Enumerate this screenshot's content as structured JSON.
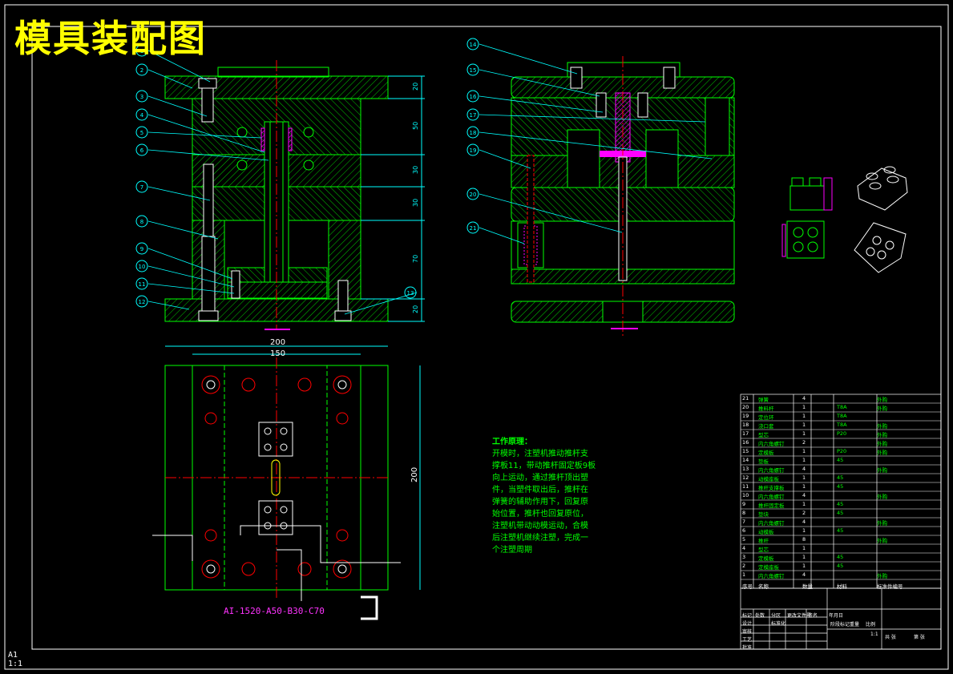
{
  "title": "模具装配图",
  "working_principle": {
    "heading": "工作原理：",
    "lines": [
      "开模时，注塑机推动推杆支",
      "撑板11，带动推杆固定板9板",
      "向上运动，通过推杆顶出塑",
      "件，当塑件取出后，推杆在",
      "弹簧的辅助作用下，回复原",
      "始位置，推杆也回复原位，",
      "注塑机带动动模运动，合模",
      "后注塑机继续注塑，完成一",
      "个注塑周期"
    ]
  },
  "base_code": "AI-1520-A50-B30-C70",
  "sheet": {
    "size": "A1",
    "scale": "1:1"
  },
  "dimensions": {
    "plan_width_outer": "200",
    "plan_width_inner": "150",
    "plan_height": "200",
    "section_heights": [
      "20",
      "50",
      "30",
      "30",
      "70",
      "20"
    ]
  },
  "balloons_left": [
    "1",
    "2",
    "3",
    "4",
    "5",
    "6",
    "7",
    "8",
    "9",
    "10",
    "11",
    "12",
    "13"
  ],
  "balloons_right": [
    "14",
    "15",
    "16",
    "17",
    "18",
    "19",
    "20",
    "21"
  ],
  "bom": {
    "rows": [
      [
        "21",
        "弹簧",
        "4",
        "",
        "外购"
      ],
      [
        "20",
        "推料杆",
        "1",
        "T8A",
        "外购"
      ],
      [
        "19",
        "定位环",
        "1",
        "T8A",
        ""
      ],
      [
        "18",
        "浇口套",
        "1",
        "T8A",
        "外购"
      ],
      [
        "17",
        "型芯",
        "1",
        "P20",
        "外购"
      ],
      [
        "16",
        "内六角螺钉",
        "2",
        "",
        "外购"
      ],
      [
        "15",
        "定模板",
        "1",
        "P20",
        "外购"
      ],
      [
        "14",
        "垫板",
        "1",
        "45",
        ""
      ],
      [
        "13",
        "内六角螺钉",
        "4",
        "",
        "外购"
      ],
      [
        "12",
        "动模座板",
        "1",
        "45",
        ""
      ],
      [
        "11",
        "推杆支撑板",
        "1",
        "45",
        ""
      ],
      [
        "10",
        "内六角螺钉",
        "4",
        "",
        "外购"
      ],
      [
        "9",
        "推杆固定板",
        "1",
        "45",
        ""
      ],
      [
        "8",
        "垫块",
        "2",
        "45",
        ""
      ],
      [
        "7",
        "内六角螺钉",
        "4",
        "",
        "外购"
      ],
      [
        "6",
        "动模板",
        "1",
        "45",
        ""
      ],
      [
        "5",
        "推杆",
        "8",
        "",
        "外购"
      ],
      [
        "4",
        "型芯",
        "1",
        "",
        ""
      ],
      [
        "3",
        "定模板",
        "1",
        "45",
        ""
      ],
      [
        "2",
        "定模座板",
        "1",
        "45",
        ""
      ],
      [
        "1",
        "内六角螺钉",
        "4",
        "",
        "外购"
      ]
    ],
    "header": [
      "序号",
      "名称",
      "数量",
      "材料",
      "标准件编号"
    ]
  },
  "title_block": {
    "labels": [
      "标记",
      "处数",
      "分区",
      "更改文件号",
      "签名",
      "年月日",
      "设计",
      "标准化",
      "审核",
      "工艺",
      "批准",
      "阶段标记",
      "重量",
      "比例",
      "共 张",
      "第 张"
    ],
    "scale_value": "1:1"
  },
  "colors": {
    "background": "#000000",
    "frame": "#ffffff",
    "title": "#ffff00",
    "green": "#00ff00",
    "cyan": "#00ffff",
    "red": "#ff0000",
    "magenta": "#ff00ff",
    "yellow": "#ffff00",
    "white": "#ffffff"
  }
}
